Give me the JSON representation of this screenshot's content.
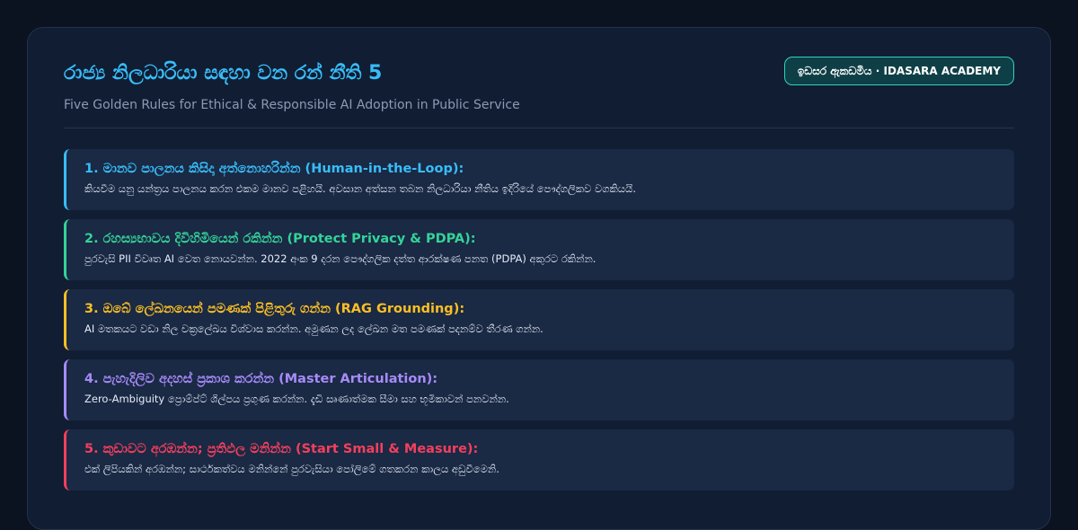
{
  "header": {
    "title": "රාජ්‍ය නිලධාරියා සඳහා වන රන් නීති 5",
    "subtitle": "Five Golden Rules for Ethical & Responsible AI Adoption in Public Service",
    "badge": "ඉඩසර ඇකඩමිය · IDASARA ACADEMY"
  },
  "colors": {
    "background": "#0b1220",
    "panel": "#111d33",
    "card": "#1a2944",
    "title": "#38bdf8",
    "badge_border": "#2dd4bf"
  },
  "rules": [
    {
      "title": "1. මානව පාලනය කිසිදා අත්නොහරින්න (Human-in-the-Loop):",
      "description": "කියවීම යනු යන්ත්‍රය පාලනය කරන එකම මානව පළිහයි. අවසාන අත්සන තබන නිලධාරියා නීතිය ඉදිරියේ පෞද්ගලිකව වගකියයි.",
      "color": "#38bdf8"
    },
    {
      "title": "2. රහස්‍යභාවය දිවිහිමියෙන් රකින්න (Protect Privacy & PDPA):",
      "description": "පුරවැසි PII විවෘත AI වෙත නොයවන්න. 2022 අංක 9 දරන පෞද්ගලික දත්ත ආරක්ෂණ පනත (PDPA) අකුරට රකින්න.",
      "color": "#34d399"
    },
    {
      "title": "3. ඔබේ ලේඛනයෙන් පමණක් පිළිතුරු ගන්න (RAG Grounding):",
      "description": "AI මතකයට වඩා නිල චක්‍රලේඛය විශ්වාස කරන්න. අමුණන ලද ලේඛන මත පමණක් පදනම්ව තීරණ ගන්න.",
      "color": "#fbbf24"
    },
    {
      "title": "4. පැහැදිලිව අදහස් ප්‍රකාශ කරන්න (Master Articulation):",
      "description": "Zero-Ambiguity ප්‍රොම්ප්ට් ශිල්පය ප්‍රගුණ කරන්න. දැඩි සෘණාත්මක සීමා සහ භූමිකාවන් පනවන්න.",
      "color": "#a78bfa"
    },
    {
      "title": "5. කුඩාවට අරඹන්න; ප්‍රතිඵල මනින්න (Start Small & Measure):",
      "description": "එක් ලිපියකින් අරඹන්න; සාර්ථකත්වය මනින්නේ පුරවැසියා පෝලිමේ ගතකරන කාලය අඩුවීමෙනි.",
      "color": "#f43f5e"
    }
  ]
}
